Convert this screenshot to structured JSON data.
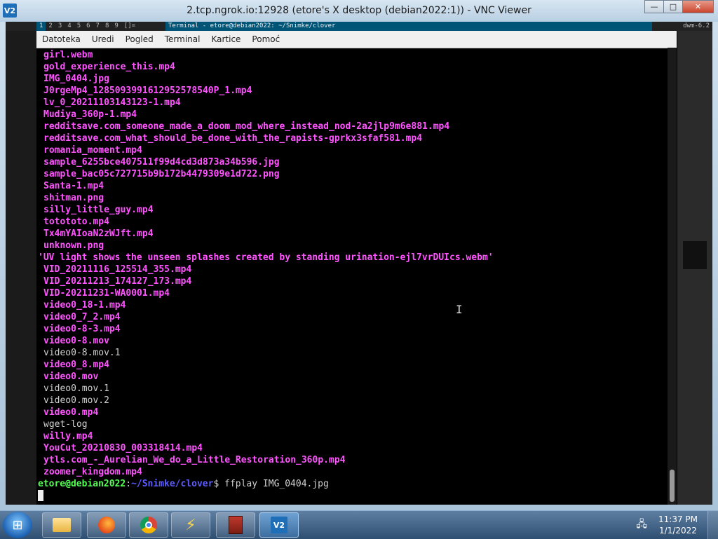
{
  "vnc": {
    "app_icon": "V2",
    "title": "2.tcp.ngrok.io:12928 (etore's X desktop (debian2022:1)) - VNC Viewer",
    "controls": {
      "minimize": "—",
      "maximize": "□",
      "close": "✕"
    }
  },
  "dwm": {
    "tags": [
      "1",
      "2",
      "3",
      "4",
      "5",
      "6",
      "7",
      "8",
      "9"
    ],
    "layout": "[]=",
    "window_title": "Terminal - etore@debian2022: ~/Snimke/clover",
    "status": "dwm-6.2"
  },
  "terminal": {
    "menu": [
      "Datoteka",
      "Uredi",
      "Pogled",
      "Terminal",
      "Kartice",
      "Pomoć"
    ],
    "lines": [
      {
        "text": "girl.webm",
        "style": "magenta"
      },
      {
        "text": "gold_experience_this.mp4",
        "style": "magenta"
      },
      {
        "text": "IMG_0404.jpg",
        "style": "magenta"
      },
      {
        "text": "J0rgeMp4_1285093991612952578540P_1.mp4",
        "style": "magenta"
      },
      {
        "text": "lv_0_20211103143123-1.mp4",
        "style": "magenta"
      },
      {
        "text": "Mudiya_360p-1.mp4",
        "style": "magenta"
      },
      {
        "text": "redditsave.com_someone_made_a_doom_mod_where_instead_nod-2a2jlp9m6e881.mp4",
        "style": "magenta"
      },
      {
        "text": "redditsave.com_what_should_be_done_with_the_rapists-gprkx3sfaf581.mp4",
        "style": "magenta"
      },
      {
        "text": "romania_moment.mp4",
        "style": "magenta"
      },
      {
        "text": "sample_6255bce407511f99d4cd3d873a34b596.jpg",
        "style": "magenta"
      },
      {
        "text": "sample_bac05c727715b9b172b4479309e1d722.png",
        "style": "magenta"
      },
      {
        "text": "Santa-1.mp4",
        "style": "magenta"
      },
      {
        "text": "shitman.png",
        "style": "magenta"
      },
      {
        "text": "silly_little_guy.mp4",
        "style": "magenta"
      },
      {
        "text": "totototo.mp4",
        "style": "magenta"
      },
      {
        "text": "Tx4mYAIoaN2zWJft.mp4",
        "style": "magenta"
      },
      {
        "text": "unknown.png",
        "style": "magenta"
      },
      {
        "text": "'UV light shows the unseen splashes created by standing urination-ejl7vrDUIcs.webm'",
        "style": "magenta quoted"
      },
      {
        "text": "VID_20211116_125514_355.mp4",
        "style": "magenta"
      },
      {
        "text": "VID_20211213_174127_173.mp4",
        "style": "magenta"
      },
      {
        "text": "VID-20211231-WA0001.mp4",
        "style": "magenta"
      },
      {
        "text": "video0_18-1.mp4",
        "style": "magenta"
      },
      {
        "text": "video0_7_2.mp4",
        "style": "magenta"
      },
      {
        "text": "video0-8-3.mp4",
        "style": "magenta"
      },
      {
        "text": "video0-8.mov",
        "style": "magenta"
      },
      {
        "text": "video0-8.mov.1",
        "style": "plain"
      },
      {
        "text": "video0_8.mp4",
        "style": "magenta"
      },
      {
        "text": "video0.mov",
        "style": "magenta"
      },
      {
        "text": "video0.mov.1",
        "style": "plain"
      },
      {
        "text": "video0.mov.2",
        "style": "plain"
      },
      {
        "text": "video0.mp4",
        "style": "magenta"
      },
      {
        "text": "wget-log",
        "style": "plain"
      },
      {
        "text": "willy.mp4",
        "style": "magenta"
      },
      {
        "text": "YouCut_20210830_003318414.mp4",
        "style": "magenta"
      },
      {
        "text": "ytls.com_-_Aurelian_We_do_a_Little_Restoration_360p.mp4",
        "style": "magenta"
      },
      {
        "text": "zoomer_kingdom.mp4",
        "style": "magenta"
      }
    ],
    "prompt": {
      "user_host": "etore@debian2022",
      "separator": ":",
      "path": "~/Snimke/clover",
      "symbol": "$",
      "command": " ffplay IMG_0404.jpg"
    }
  },
  "taskbar": {
    "items": [
      {
        "name": "explorer-icon",
        "label": "Windows Explorer"
      },
      {
        "name": "firefox-icon",
        "label": "Firefox"
      },
      {
        "name": "chrome-icon",
        "label": "Google Chrome"
      },
      {
        "name": "winamp-icon",
        "label": "Winamp"
      },
      {
        "name": "book-app-icon",
        "label": "Application"
      },
      {
        "name": "vnc-viewer-icon",
        "label": "VNC Viewer"
      }
    ],
    "clock": {
      "time": "11:37 PM",
      "date": "1/1/2022"
    }
  }
}
